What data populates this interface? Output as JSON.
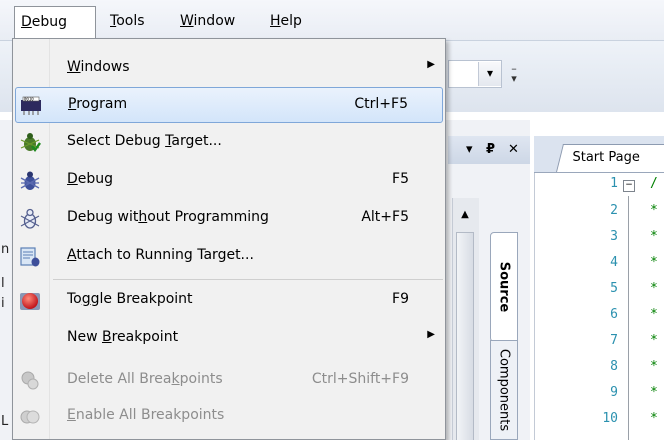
{
  "menubar": {
    "debug": {
      "label": "Debug",
      "u": "D",
      "rest": "ebug"
    },
    "tools": {
      "label": "Tools",
      "u": "T",
      "rest": "ools"
    },
    "window": {
      "label": "Window",
      "u": "W",
      "rest": "indow"
    },
    "help": {
      "label": "Help",
      "u": "H",
      "rest": "elp"
    }
  },
  "panel": {
    "pin": "₽",
    "close": "✕",
    "dropdown": "▾"
  },
  "toolbar": {
    "overflow": "▾"
  },
  "vtabs": {
    "source": "Source",
    "components": "Components"
  },
  "editor": {
    "tab_label": "Start Page",
    "line_numbers": [
      "1",
      "2",
      "3",
      "4",
      "5",
      "6",
      "7",
      "8",
      "9",
      "10"
    ],
    "code": [
      "/",
      "*",
      "*",
      "*",
      "*",
      "*",
      "*",
      "*",
      "*",
      "*"
    ]
  },
  "edge_text": [
    "n",
    "l",
    "i",
    "L"
  ],
  "menu": {
    "items": [
      {
        "name": "windows",
        "pre": "",
        "u": "W",
        "post": "indows",
        "shortcut": "",
        "submenu": true,
        "icon": ""
      },
      {
        "name": "program",
        "pre": "",
        "u": "P",
        "post": "rogram",
        "shortcut": "Ctrl+F5",
        "submenu": false,
        "icon": "chip-icon",
        "highlighted": true
      },
      {
        "name": "select-debug-target",
        "pre": "Select Debug ",
        "u": "T",
        "post": "arget...",
        "shortcut": "",
        "submenu": false,
        "icon": "bug-target-icon"
      },
      {
        "name": "debug",
        "pre": "",
        "u": "D",
        "post": "ebug",
        "shortcut": "F5",
        "submenu": false,
        "icon": "bug-icon"
      },
      {
        "name": "debug-without-programming",
        "pre": "Debug wit",
        "u": "h",
        "post": "out Programming",
        "shortcut": "Alt+F5",
        "submenu": false,
        "icon": "bug-outline-icon"
      },
      {
        "name": "attach-to-running-target",
        "pre": "",
        "u": "A",
        "post": "ttach to Running Target...",
        "shortcut": "",
        "submenu": false,
        "icon": "attach-icon"
      },
      {
        "name": "toggle-breakpoint",
        "pre": "To",
        "u": "g",
        "post": "gle Breakpoint",
        "shortcut": "F9",
        "submenu": false,
        "icon": "breakpoint-icon"
      },
      {
        "name": "new-breakpoint",
        "pre": "New ",
        "u": "B",
        "post": "reakpoint",
        "shortcut": "",
        "submenu": true,
        "icon": ""
      },
      {
        "name": "delete-all-breakpoints",
        "pre": "Delete All Brea",
        "u": "k",
        "post": "points",
        "shortcut": "Ctrl+Shift+F9",
        "submenu": false,
        "icon": "delete-breakpoints-icon",
        "disabled": true
      },
      {
        "name": "enable-all-breakpoints",
        "pre": "",
        "u": "E",
        "post": "nable All Breakpoints",
        "shortcut": "",
        "submenu": false,
        "icon": "enable-breakpoints-icon",
        "disabled": true
      }
    ],
    "submenu_arrow": "▶"
  }
}
